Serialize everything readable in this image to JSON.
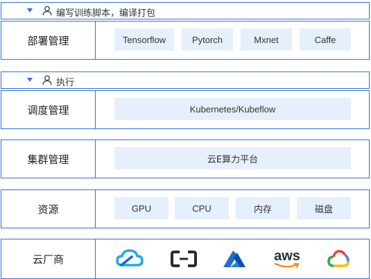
{
  "header1": {
    "text": "编写训练脚本，编译打包"
  },
  "row_deploy": {
    "label": "部署管理",
    "items": [
      "Tensorflow",
      "Pytorch",
      "Mxnet",
      "Caffe"
    ]
  },
  "header2": {
    "text": "执行"
  },
  "row_schedule": {
    "label": "调度管理",
    "item": "Kubernetes/Kubeflow"
  },
  "row_cluster": {
    "label": "集群管理",
    "item": "云E算力平台"
  },
  "row_resource": {
    "label": "资源",
    "items": [
      "GPU",
      "CPU",
      "内存",
      "磁盘"
    ]
  },
  "row_cloud": {
    "label": "云厂商",
    "logos": [
      "tencent-cloud-logo",
      "alibaba-cloud-logo",
      "azure-logo",
      "aws-logo",
      "google-cloud-logo"
    ],
    "aws_text": "aws"
  },
  "colors": {
    "border": "#2f6fd6",
    "chip": "#e6effc"
  }
}
